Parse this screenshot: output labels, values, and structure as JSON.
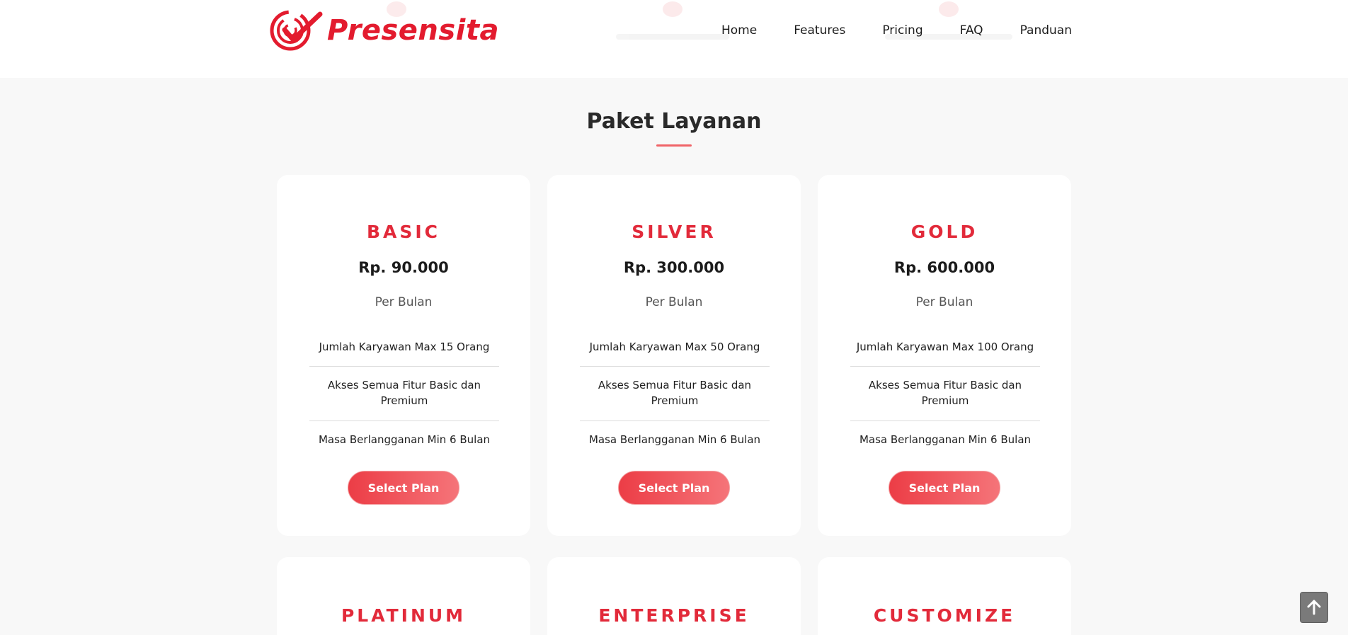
{
  "brand": {
    "name": "Presensita",
    "color": "#e31b2e"
  },
  "nav": [
    "Home",
    "Features",
    "Pricing",
    "FAQ",
    "Panduan"
  ],
  "section": {
    "title": "Paket Layanan",
    "accent": "#f06468"
  },
  "plans": [
    {
      "name": "BASIC",
      "price": "Rp. 90.000",
      "period": "Per Bulan",
      "features": [
        "Jumlah Karyawan Max 15 Orang",
        "Akses Semua Fitur Basic dan Premium",
        "Masa Berlangganan Min 6 Bulan"
      ],
      "cta": "Select Plan"
    },
    {
      "name": "SILVER",
      "price": "Rp. 300.000",
      "period": "Per Bulan",
      "features": [
        "Jumlah Karyawan Max 50 Orang",
        "Akses Semua Fitur Basic dan Premium",
        "Masa Berlangganan Min 6 Bulan"
      ],
      "cta": "Select Plan"
    },
    {
      "name": "GOLD",
      "price": "Rp. 600.000",
      "period": "Per Bulan",
      "features": [
        "Jumlah Karyawan Max 100 Orang",
        "Akses Semua Fitur Basic dan Premium",
        "Masa Berlangganan Min 6 Bulan"
      ],
      "cta": "Select Plan"
    },
    {
      "name": "PLATINUM"
    },
    {
      "name": "ENTERPRISE"
    },
    {
      "name": "CUSTOMIZE"
    }
  ],
  "icons": {
    "back_to_top": "arrow-up-icon"
  },
  "colors": {
    "plan_name": "#e22a3a",
    "button_start": "#ec3d46",
    "button_end": "#f57479",
    "page_bg": "#f8f8f8"
  }
}
